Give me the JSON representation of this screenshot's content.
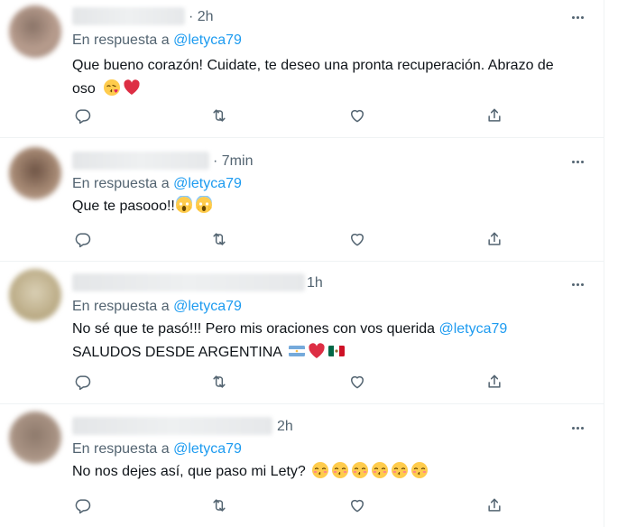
{
  "tweets": [
    {
      "time": "2h",
      "reply_prefix": "En respuesta a",
      "reply_handle": "@letyca79",
      "text_line1": "Que bueno corazón! Cuidate, te deseo una pronta recuperación. Abrazo de",
      "text_line2": "oso",
      "emojis": [
        "kissing-heart-emoji",
        "red-heart-emoji"
      ]
    },
    {
      "time": "7min",
      "reply_prefix": "En respuesta a",
      "reply_handle": "@letyca79",
      "text_line1": "Que te pasooo!!",
      "emojis": [
        "screaming-face-emoji",
        "screaming-face-emoji"
      ]
    },
    {
      "time": "1h",
      "reply_prefix": "En respuesta a",
      "reply_handle": "@letyca79",
      "text_line1": "No sé que te pasó!!! Pero mis oraciones con vos querida",
      "text_line1_handle": "@letyca79",
      "text_line2": "SALUDOS DESDE ARGENTINA",
      "emojis": [
        "argentina-flag-emoji",
        "red-heart-emoji",
        "mexico-flag-emoji"
      ]
    },
    {
      "time": "2h",
      "reply_prefix": "En respuesta a",
      "reply_handle": "@letyca79",
      "text_line1": "No nos dejes así, que paso mi Lety?",
      "emojis": [
        "kissing-face-emoji",
        "kissing-face-emoji",
        "kissing-face-emoji",
        "kissing-face-emoji",
        "kissing-face-emoji",
        "kissing-face-emoji"
      ]
    }
  ],
  "actions": [
    "reply-icon",
    "retweet-icon",
    "like-icon",
    "share-icon"
  ],
  "colors": {
    "text": "#0f1419",
    "muted": "#536471",
    "accent": "#1d9bf0",
    "heart": "#e0245e"
  }
}
